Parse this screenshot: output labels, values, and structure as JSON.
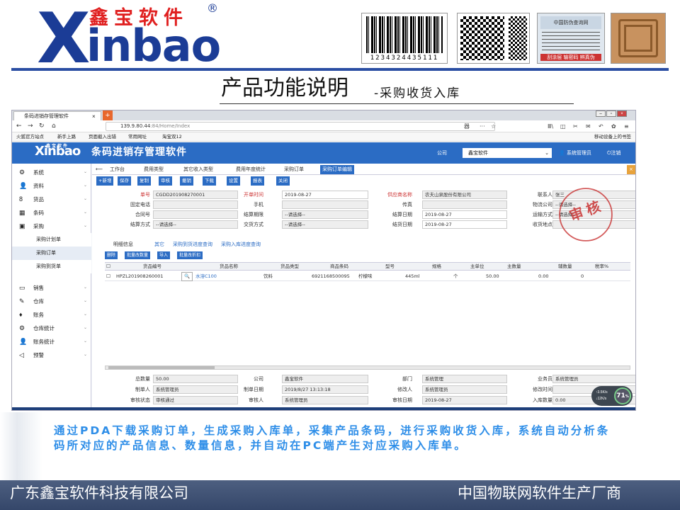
{
  "header": {
    "logo_x": "X",
    "logo_inbao": "inbao",
    "logo_cn": "鑫宝软件",
    "logo_reg": "®",
    "barcode_number": "1234324435111",
    "seal_label": "中国防伪查询网",
    "seal_footer": "刮涂层 输密码 辨真伪"
  },
  "slide": {
    "title": "产品功能说明",
    "subtitle": "-采购收货入库",
    "description": "通过PDA下载采购订单，生成采购入库单，采集产品条码，进行采购收货入库，系统自动分析条码所对应的产品信息、数量信息，并自动在PC端产生对应采购入库单。",
    "footer_left": "广东鑫宝软件科技有限公司",
    "footer_right": "中国物联网软件生产厂商"
  },
  "browser": {
    "tab_title": "条码进销存管理软件",
    "tab_close": "×",
    "new_tab": "+",
    "url_host": "139.9.80.44",
    "url_rest": ":84/Home/Index",
    "zoom": "器",
    "menu": "···",
    "bookmarks": [
      "火狐官方站点",
      "新手上路",
      "页面截入出错",
      "常用网址",
      "淘宝双12"
    ],
    "mobile_bookmarks": "移动设备上的书签"
  },
  "app": {
    "logo": "Xinbao",
    "logo_cn": "鑫宝软件",
    "name": "条码进销存管理软件",
    "company_label": "公司",
    "company_value": "鑫宝软件",
    "user": "系统管理员",
    "logout": "注销",
    "sidebar": [
      {
        "label": "系统",
        "icon": "gear-icon",
        "glyph": "⚙"
      },
      {
        "label": "资料",
        "icon": "user-icon",
        "glyph": "👤"
      },
      {
        "label": "货品",
        "icon": "goods-icon",
        "glyph": "8"
      },
      {
        "label": "条码",
        "icon": "barcode-icon",
        "glyph": "▦"
      },
      {
        "label": "采购",
        "icon": "purchase-icon",
        "glyph": "▣"
      },
      {
        "label": "采购计划单",
        "sub": true
      },
      {
        "label": "采购订单",
        "sub": true,
        "active": true
      },
      {
        "label": "采购到货单",
        "sub": true
      },
      {
        "label": "销售",
        "icon": "monitor-icon",
        "glyph": "▭"
      },
      {
        "label": "仓库",
        "icon": "edit-icon",
        "glyph": "✎"
      },
      {
        "label": "账务",
        "icon": "account-icon",
        "glyph": "♦"
      },
      {
        "label": "仓库统计",
        "icon": "gear2-icon",
        "glyph": "⚙"
      },
      {
        "label": "账务统计",
        "icon": "user2-icon",
        "glyph": "👤"
      },
      {
        "label": "预警",
        "icon": "alarm-icon",
        "glyph": "◁"
      }
    ],
    "page_tabs": [
      "工作台",
      "费用类型",
      "其它收入类型",
      "费用年度统计",
      "采购订单",
      "采购订单编辑"
    ],
    "toolbar": [
      "+新增",
      "保存",
      "复制",
      "审核",
      "撤销",
      "下载",
      "设置",
      "报表",
      "关闭"
    ],
    "form": {
      "row1": {
        "l1": "单号",
        "v1": "CGDD201908270001",
        "l2": "开单时间",
        "v2": "2019-08-27",
        "l3": "供应商名称",
        "v3": "农夫山泉股份有限公司",
        "l4": "联系人",
        "v4": "张三"
      },
      "row2": {
        "l1": "固定电话",
        "l2": "手机",
        "l3": "传真",
        "l4": "物流公司",
        "v4": "--请选择--"
      },
      "row3": {
        "l1": "合同号",
        "l2": "结算期限",
        "v2": "--请选择--",
        "l3": "结算日期",
        "v3": "2019-08-27",
        "l4": "运输方式",
        "v4": "--请选择--"
      },
      "row4": {
        "l1": "结算方式",
        "v1": "--请选择--",
        "l2": "交货方式",
        "v2": "--请选择--",
        "l3": "结货日期",
        "v3": "2019-08-27",
        "l4": "收货地点"
      }
    },
    "stamp": "审核",
    "sub_tabs": [
      "明细信息",
      "其它",
      "采购到货进度查询",
      "采购入库进度查询"
    ],
    "grid_buttons": [
      "删除",
      "批量改数量",
      "导入",
      "批量改折扣"
    ],
    "columns": [
      "货品编号",
      "货品名称",
      "货品类型",
      "商品条码",
      "型号",
      "规格",
      "主单位",
      "主数量",
      "辅数量",
      "税率%"
    ],
    "rows": [
      {
        "code": "HPZL201908260001",
        "name": "水溶C100",
        "type": "饮料",
        "barcode": "6921168500095",
        "model": "柠檬味",
        "spec": "445ml",
        "unit": "个",
        "qty": "50.00",
        "aux": "0.00",
        "tax": "0"
      }
    ],
    "footer": {
      "r1": {
        "l1": "总数量",
        "v1": "50.00",
        "l2": "公司",
        "v2": "鑫宝软件",
        "l3": "部门",
        "v3": "系统管理",
        "l4": "业务员",
        "v4": "系统管理员"
      },
      "r2": {
        "l1": "制单人",
        "v1": "系统管理员",
        "l2": "制单日期",
        "v2": "2019/8/27 13:13:18",
        "l3": "修改人",
        "v3": "系统管理员",
        "l4": "修改时间"
      },
      "r3": {
        "l1": "审核状态",
        "v1": "审核通过",
        "l2": "审核人",
        "v2": "系统管理员",
        "l3": "审核日期",
        "v3": "2019-08-27",
        "l4": "入库数量",
        "v4": "0.00"
      }
    },
    "speed": {
      "up": "3.5",
      "down": "12",
      "unit": "K/s",
      "pct": "71",
      "pct_sign": "%"
    }
  }
}
